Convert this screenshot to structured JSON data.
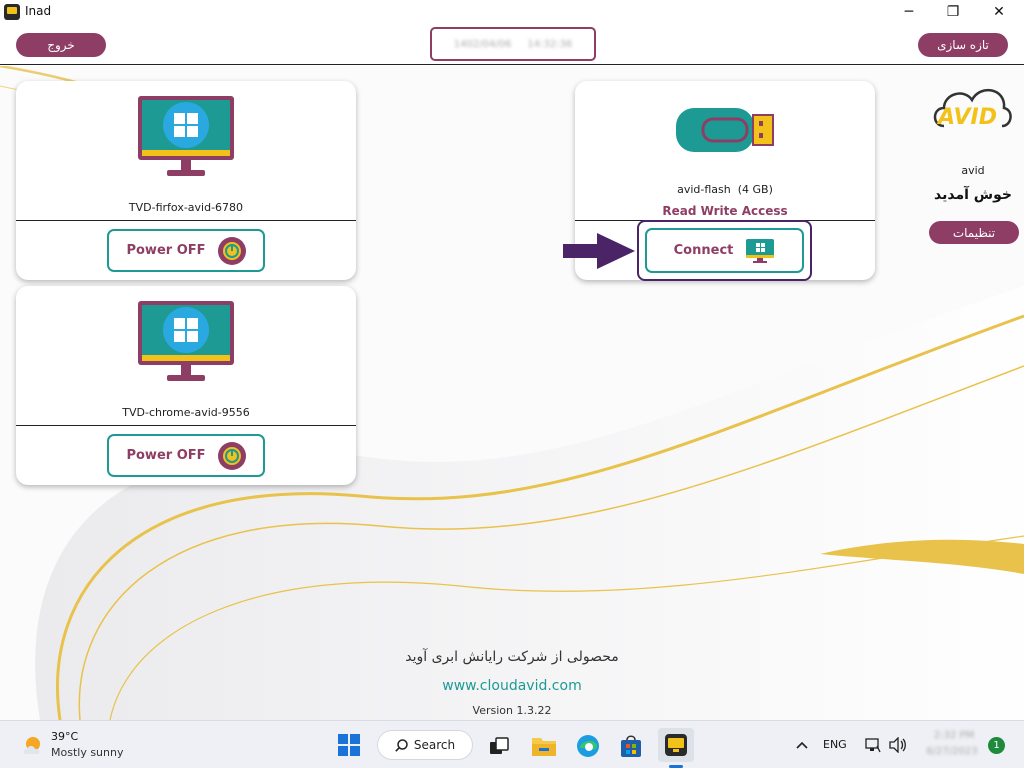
{
  "window": {
    "title": "Inad",
    "minimize": "─",
    "maximize": "❐",
    "close": "✕"
  },
  "header": {
    "logout_label": "خروج",
    "refresh_label": "تازه سازی",
    "date_blurred": "1402/04/06",
    "time_blurred": "14:32:36"
  },
  "desktops": [
    {
      "name": "TVD-firfox-avid-6780",
      "button_label": "Power OFF"
    },
    {
      "name": "TVD-chrome-avid-9556",
      "button_label": "Power OFF"
    }
  ],
  "flash": {
    "name": "avid-flash",
    "size": "(4 GB)",
    "access": "Read Write Access",
    "button_label": "Connect"
  },
  "sidebar": {
    "logo_text": "AVID",
    "username": "avid",
    "welcome": "خوش آمدید",
    "settings_label": "تنظیمات"
  },
  "footer": {
    "product_text": "محصولی از شرکت رایانش ابری آوید",
    "url": "www.cloudavid.com",
    "version": "Version 1.3.22"
  },
  "taskbar": {
    "weather_temp": "39°C",
    "weather_desc": "Mostly sunny",
    "search_label": "Search",
    "language": "ENG",
    "clock_time_blurred": "2:32 PM",
    "clock_date_blurred": "6/27/2023",
    "notification_count": "1"
  },
  "colors": {
    "brand": "#8e3e64",
    "teal": "#1e9a95",
    "gold": "#e8c24a",
    "arrow": "#4a2466"
  }
}
